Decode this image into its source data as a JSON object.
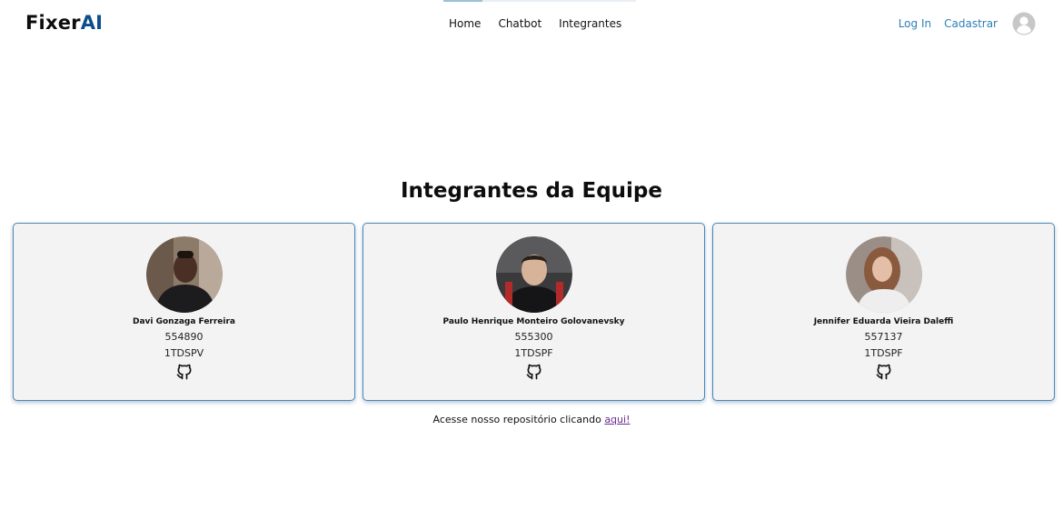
{
  "brand": {
    "part1": "Fixer",
    "part2": "AI"
  },
  "nav": {
    "items": [
      {
        "label": "Home"
      },
      {
        "label": "Chatbot"
      },
      {
        "label": "Integrantes"
      }
    ]
  },
  "auth": {
    "login": "Log In",
    "signup": "Cadastrar",
    "avatar_icon": "user-circle-icon"
  },
  "main": {
    "title": "Integrantes da Equipe",
    "members": [
      {
        "name": "Davi Gonzaga Ferreira",
        "rm": "554890",
        "class": "1TDSPV",
        "icon": "github-icon"
      },
      {
        "name": "Paulo Henrique Monteiro Golovanevsky",
        "rm": "555300",
        "class": "1TDSPF",
        "icon": "github-icon"
      },
      {
        "name": "Jennifer Eduarda Vieira Daleffi",
        "rm": "557137",
        "class": "1TDSPF",
        "icon": "github-icon"
      }
    ],
    "repo": {
      "text": "Acesse nosso repositório clicando ",
      "link": "aqui!"
    }
  },
  "colors": {
    "brand_accent": "#0b4e8c",
    "link": "#2d7fb8",
    "card_border": "#4a86b4",
    "visited_link": "#6a2d8f"
  }
}
